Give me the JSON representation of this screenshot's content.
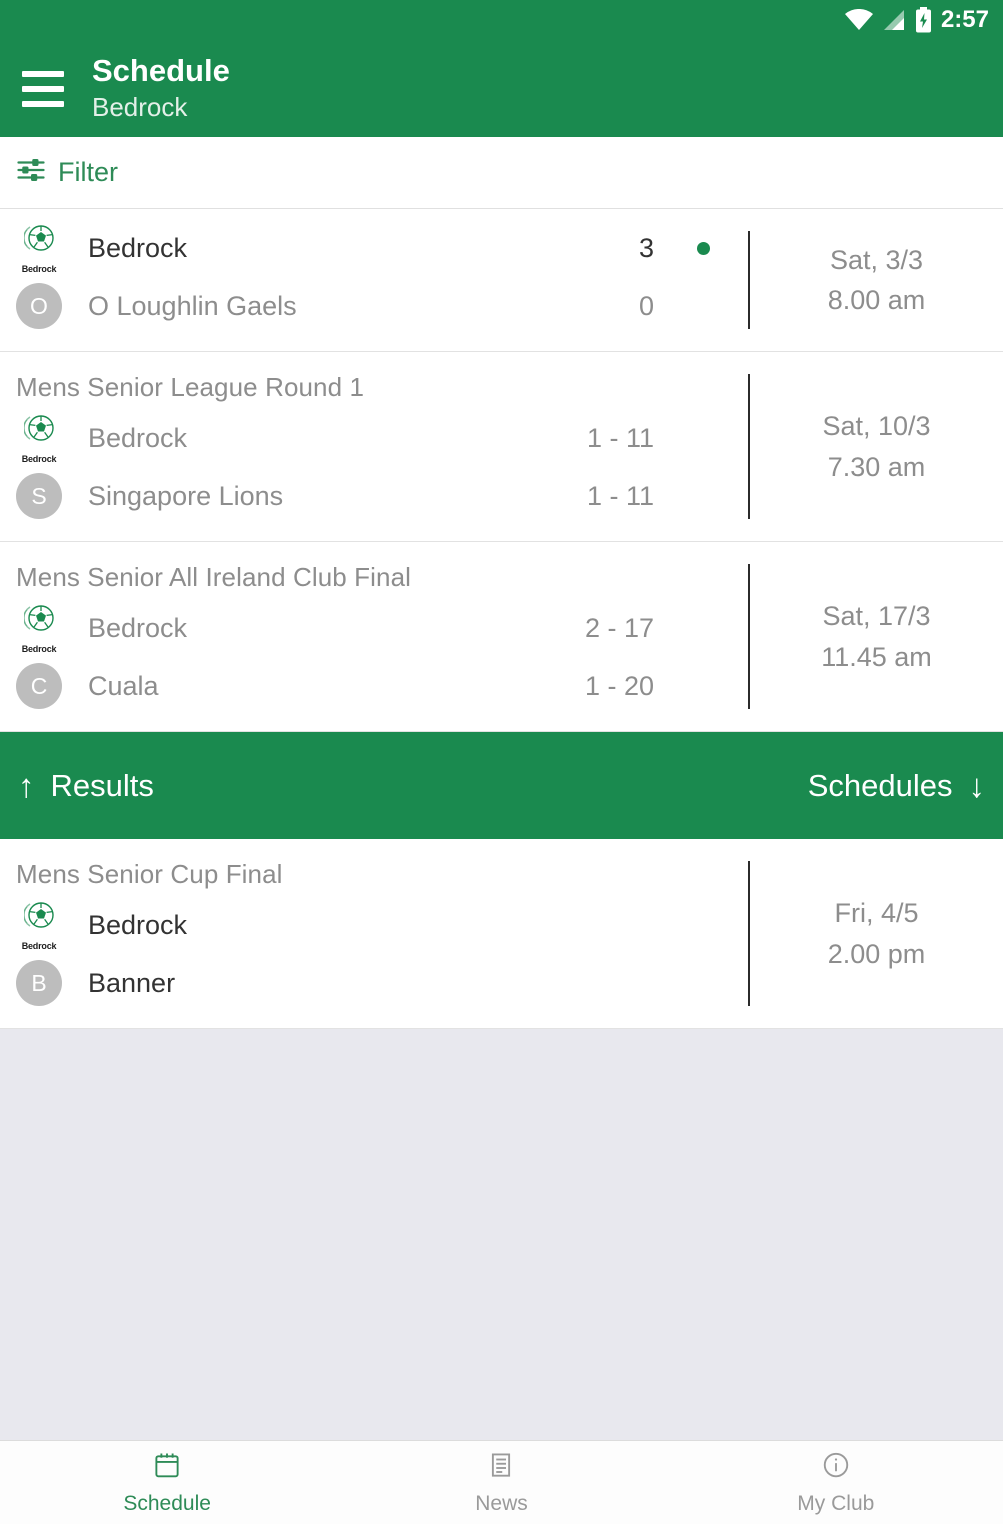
{
  "status_bar": {
    "time": "2:57",
    "wifi_icon": "wifi-icon",
    "signal_icon": "cellular-signal-icon",
    "battery_icon": "battery-charging-icon"
  },
  "app_bar": {
    "menu_icon": "hamburger-menu-icon",
    "title": "Schedule",
    "subtitle": "Bedrock"
  },
  "filter": {
    "icon": "tune-sliders-icon",
    "label": "Filter"
  },
  "colors": {
    "brand_green": "#1a8a4f",
    "accent_green": "#2e8b57",
    "muted_text": "#8d8d8d",
    "dark_text": "#333333",
    "page_bg": "#e8e8ee",
    "badge_gray": "#bdbdbd"
  },
  "results": [
    {
      "competition": "",
      "date": "Sat, 3/3",
      "time": "8.00 am",
      "has_live_dot": true,
      "teams": [
        {
          "name": "Bedrock",
          "score": "3",
          "badge": "bedrock-logo",
          "badge_letter": "",
          "highlight": true
        },
        {
          "name": "O Loughlin Gaels",
          "score": "0",
          "badge": "letter-avatar",
          "badge_letter": "O",
          "highlight": false
        }
      ]
    },
    {
      "competition": "Mens Senior League Round 1",
      "date": "Sat, 10/3",
      "time": "7.30 am",
      "has_live_dot": false,
      "teams": [
        {
          "name": "Bedrock",
          "score": "1 - 11",
          "badge": "bedrock-logo",
          "badge_letter": "",
          "highlight": false
        },
        {
          "name": "Singapore Lions",
          "score": "1 - 11",
          "badge": "letter-avatar",
          "badge_letter": "S",
          "highlight": false
        }
      ]
    },
    {
      "competition": "Mens Senior All Ireland Club Final",
      "date": "Sat, 17/3",
      "time": "11.45 am",
      "has_live_dot": false,
      "teams": [
        {
          "name": "Bedrock",
          "score": "2 - 17",
          "badge": "bedrock-logo",
          "badge_letter": "",
          "highlight": false
        },
        {
          "name": "Cuala",
          "score": "1 - 20",
          "badge": "letter-avatar",
          "badge_letter": "C",
          "highlight": false
        }
      ]
    }
  ],
  "band": {
    "left_label": "Results",
    "left_arrow": "arrow-up-icon",
    "right_label": "Schedules",
    "right_arrow": "arrow-down-icon"
  },
  "schedules": [
    {
      "competition": "Mens Senior Cup Final",
      "date": "Fri, 4/5",
      "time": "2.00 pm",
      "has_live_dot": false,
      "teams": [
        {
          "name": "Bedrock",
          "score": "",
          "badge": "bedrock-logo",
          "badge_letter": "",
          "highlight": true
        },
        {
          "name": "Banner",
          "score": "",
          "badge": "letter-avatar",
          "badge_letter": "B",
          "highlight": true
        }
      ]
    }
  ],
  "bottom_nav": [
    {
      "label": "Schedule",
      "icon": "calendar-icon",
      "active": true
    },
    {
      "label": "News",
      "icon": "article-icon",
      "active": false
    },
    {
      "label": "My Club",
      "icon": "info-circle-icon",
      "active": false
    }
  ]
}
